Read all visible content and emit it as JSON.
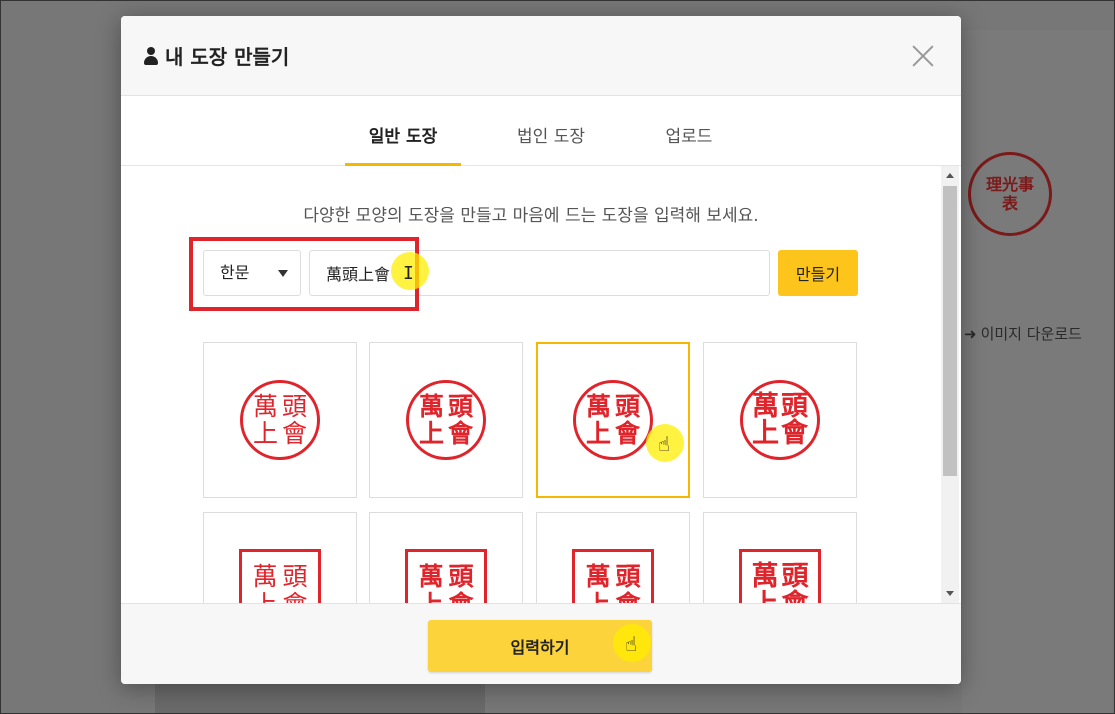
{
  "background": {
    "download_label": "이미지 다운로드",
    "seal_chars": "理光事表"
  },
  "modal": {
    "title": "내 도장 만들기",
    "tabs": [
      {
        "label": "일반 도장",
        "active": true
      },
      {
        "label": "법인 도장",
        "active": false
      },
      {
        "label": "업로드",
        "active": false
      }
    ],
    "description": "다양한 모양의 도장을 만들고 마음에 드는 도장을 입력해 보세요.",
    "script_select": {
      "value": "한문"
    },
    "name_input": {
      "value": "萬頭上會"
    },
    "make_button": "만들기",
    "seal_chars": [
      "萬",
      "頭",
      "上",
      "會"
    ],
    "seal_styles": [
      {
        "shape": "circle",
        "style": "thin",
        "selected": false
      },
      {
        "shape": "circle",
        "style": "bold",
        "selected": false
      },
      {
        "shape": "circle",
        "style": "bold",
        "selected": true
      },
      {
        "shape": "circle",
        "style": "heavy",
        "selected": false
      },
      {
        "shape": "square",
        "style": "thin",
        "selected": false
      },
      {
        "shape": "square",
        "style": "bold",
        "selected": false
      },
      {
        "shape": "square",
        "style": "bold",
        "selected": false
      },
      {
        "shape": "square",
        "style": "heavy",
        "selected": false
      }
    ],
    "submit_button": "입력하기"
  },
  "colors": {
    "accent": "#fdc41b",
    "seal_red": "#e0242b",
    "highlight_red": "#e0242b"
  }
}
